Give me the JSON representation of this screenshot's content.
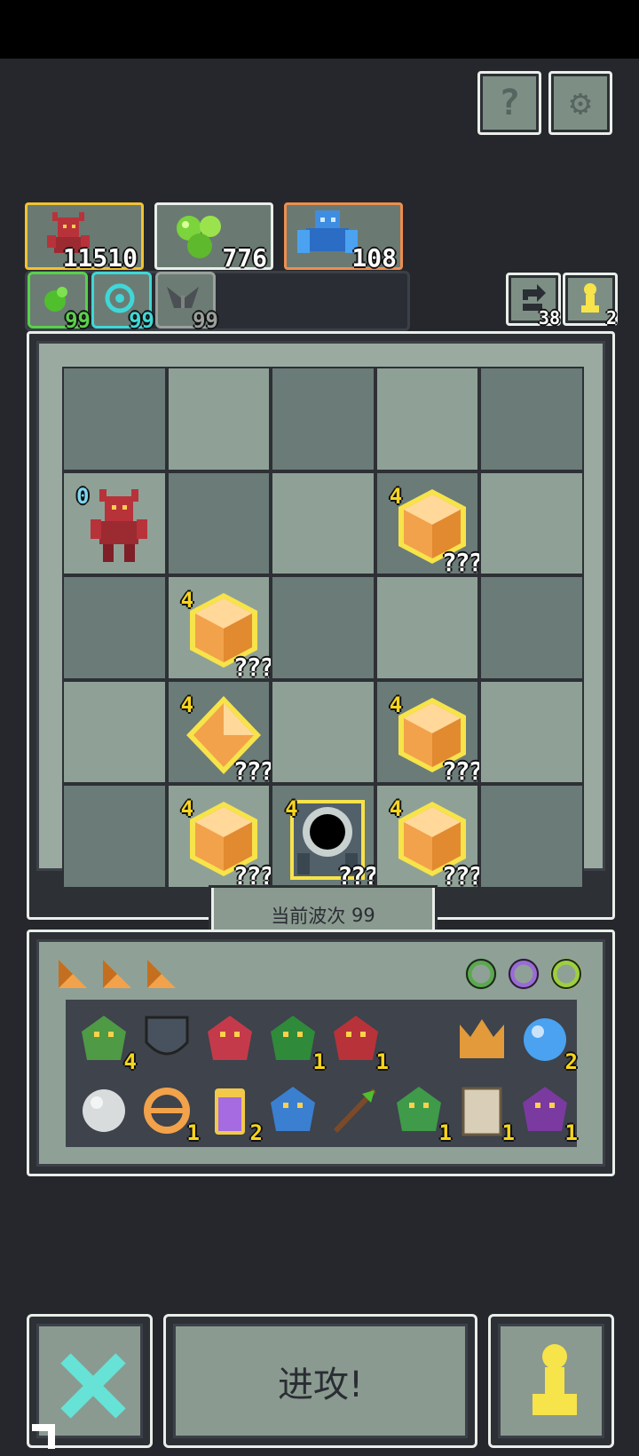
{
  "header": {
    "help_icon": "question-icon",
    "settings_icon": "gear-icon",
    "help_glyph": "?",
    "settings_glyph": "⚙"
  },
  "resources": [
    {
      "icon": "red-demon-icon",
      "value": "11510",
      "border": "#f1c232"
    },
    {
      "icon": "green-slime-icon",
      "value": "776",
      "border": "#e9eee9"
    },
    {
      "icon": "blue-golem-icon",
      "value": "108",
      "border": "#ee8e4f"
    }
  ],
  "bonuses": [
    {
      "icon": "green-orb-icon",
      "value": "99",
      "color": "#58d14a"
    },
    {
      "icon": "cyan-swirl-icon",
      "value": "99",
      "color": "#3fd7d7"
    },
    {
      "icon": "grey-wing-icon",
      "value": "99",
      "color": "#9aa09c"
    }
  ],
  "counters": {
    "recycle": {
      "icon": "recycle-arrow-icon",
      "value": "38"
    },
    "pawn": {
      "icon": "pawn-icon",
      "value": "2"
    }
  },
  "board": {
    "enemy": {
      "row": 1,
      "col": 0,
      "level": "0"
    },
    "pieces": [
      {
        "row": 1,
        "col": 3,
        "type": "cube",
        "level": "4",
        "label": "???"
      },
      {
        "row": 2,
        "col": 1,
        "type": "cube",
        "level": "4",
        "label": "???"
      },
      {
        "row": 3,
        "col": 1,
        "type": "crystal",
        "level": "4",
        "label": "???"
      },
      {
        "row": 3,
        "col": 3,
        "type": "cube",
        "level": "4",
        "label": "???"
      },
      {
        "row": 4,
        "col": 1,
        "type": "cube",
        "level": "4",
        "label": "???"
      },
      {
        "row": 4,
        "col": 2,
        "type": "portal",
        "level": "4",
        "label": "???"
      },
      {
        "row": 4,
        "col": 3,
        "type": "cube",
        "level": "4",
        "label": "???"
      }
    ]
  },
  "wave": {
    "label": "当前波次",
    "value": "99"
  },
  "inventory": {
    "tabs": [
      "shard-icon",
      "shard-icon",
      "shard-icon"
    ],
    "rings": [
      {
        "icon": "ring-green-icon",
        "color": "#5aa84f"
      },
      {
        "icon": "ring-purple-icon",
        "color": "#9a6bd6"
      },
      {
        "icon": "ring-lime-icon",
        "color": "#9bd03c"
      }
    ],
    "row1": [
      {
        "icon": "goblin-arrow-icon",
        "count": "4"
      },
      {
        "icon": "shield-icon",
        "count": ""
      },
      {
        "icon": "beetle-icon",
        "count": ""
      },
      {
        "icon": "hooded-demon-icon",
        "count": "1"
      },
      {
        "icon": "red-hood-icon",
        "count": "1"
      },
      {
        "icon": "",
        "count": ""
      },
      {
        "icon": "crown-claw-icon",
        "count": ""
      },
      {
        "icon": "blue-orb-icon",
        "count": "2"
      }
    ],
    "row2": [
      {
        "icon": "stone-egg-icon",
        "count": ""
      },
      {
        "icon": "ring-theta-icon",
        "count": "1"
      },
      {
        "icon": "potion-jar-icon",
        "count": "2"
      },
      {
        "icon": "blue-flame-icon",
        "count": ""
      },
      {
        "icon": "arrow-icon",
        "count": ""
      },
      {
        "icon": "goblin-rider-icon",
        "count": "1"
      },
      {
        "icon": "scroll-icon",
        "count": "1"
      },
      {
        "icon": "bat-emblem-icon",
        "count": "1"
      }
    ]
  },
  "actions": {
    "cancel_icon": "cross-icon",
    "attack_label": "进攻!",
    "pawn_icon": "pawn-icon"
  },
  "colors": {
    "background": "#25272c",
    "cube_orange": "#f2a24a",
    "level_yellow": "#f7d51d"
  }
}
